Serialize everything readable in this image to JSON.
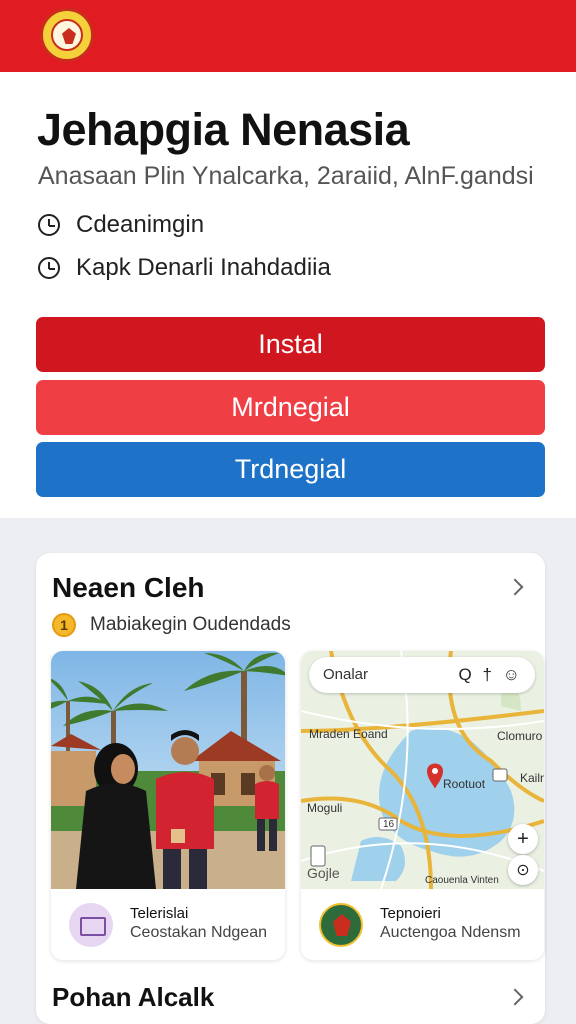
{
  "header": {
    "logo_icon": "garuda-emblem-icon",
    "brand_color": "#e01b22"
  },
  "app": {
    "title": "Jehapgia Nenasia",
    "subtitle": "Anasaan Plin Ynalcarka, 2araiid, AlnF.gandsi",
    "meta": [
      {
        "icon": "clock-icon",
        "text": "Cdeanimgin"
      },
      {
        "icon": "clock-icon",
        "text": "Kapk Denarli Inahdadiia"
      }
    ]
  },
  "actions": {
    "install_label": "Instal",
    "second_label": "Mrdnegial",
    "third_label": "Trdnegial",
    "colors": {
      "install": "#d0161e",
      "second": "#ef3f45",
      "third": "#1e73c8"
    }
  },
  "section1": {
    "title": "Neaen Cleh",
    "badge_number": "1",
    "badge_text": "Mabiakegin Oudendads",
    "tiles": [
      {
        "image": "people-in-front-of-house-photo",
        "icon": "card-icon",
        "title": "Telerislai",
        "subtitle": "Ceostakan Ndgean"
      },
      {
        "image": "map-view",
        "icon": "emblem-icon",
        "title": "Tepnoieri",
        "subtitle": "Auctengoa Ndensm"
      }
    ]
  },
  "map": {
    "search_placeholder": "Onalar",
    "tools": "Q † ☺",
    "labels": {
      "west": "Mraden Eoand",
      "east": "Clomuro",
      "pin": "Rootuot",
      "road_west": "Moguli",
      "road_east": "Kailn",
      "route": "16",
      "logo": "Gojle",
      "attribution": "Caouenla Vinten"
    },
    "zoom_in": "+",
    "locate": "⊙"
  },
  "section2": {
    "title": "Pohan Alcalk"
  }
}
